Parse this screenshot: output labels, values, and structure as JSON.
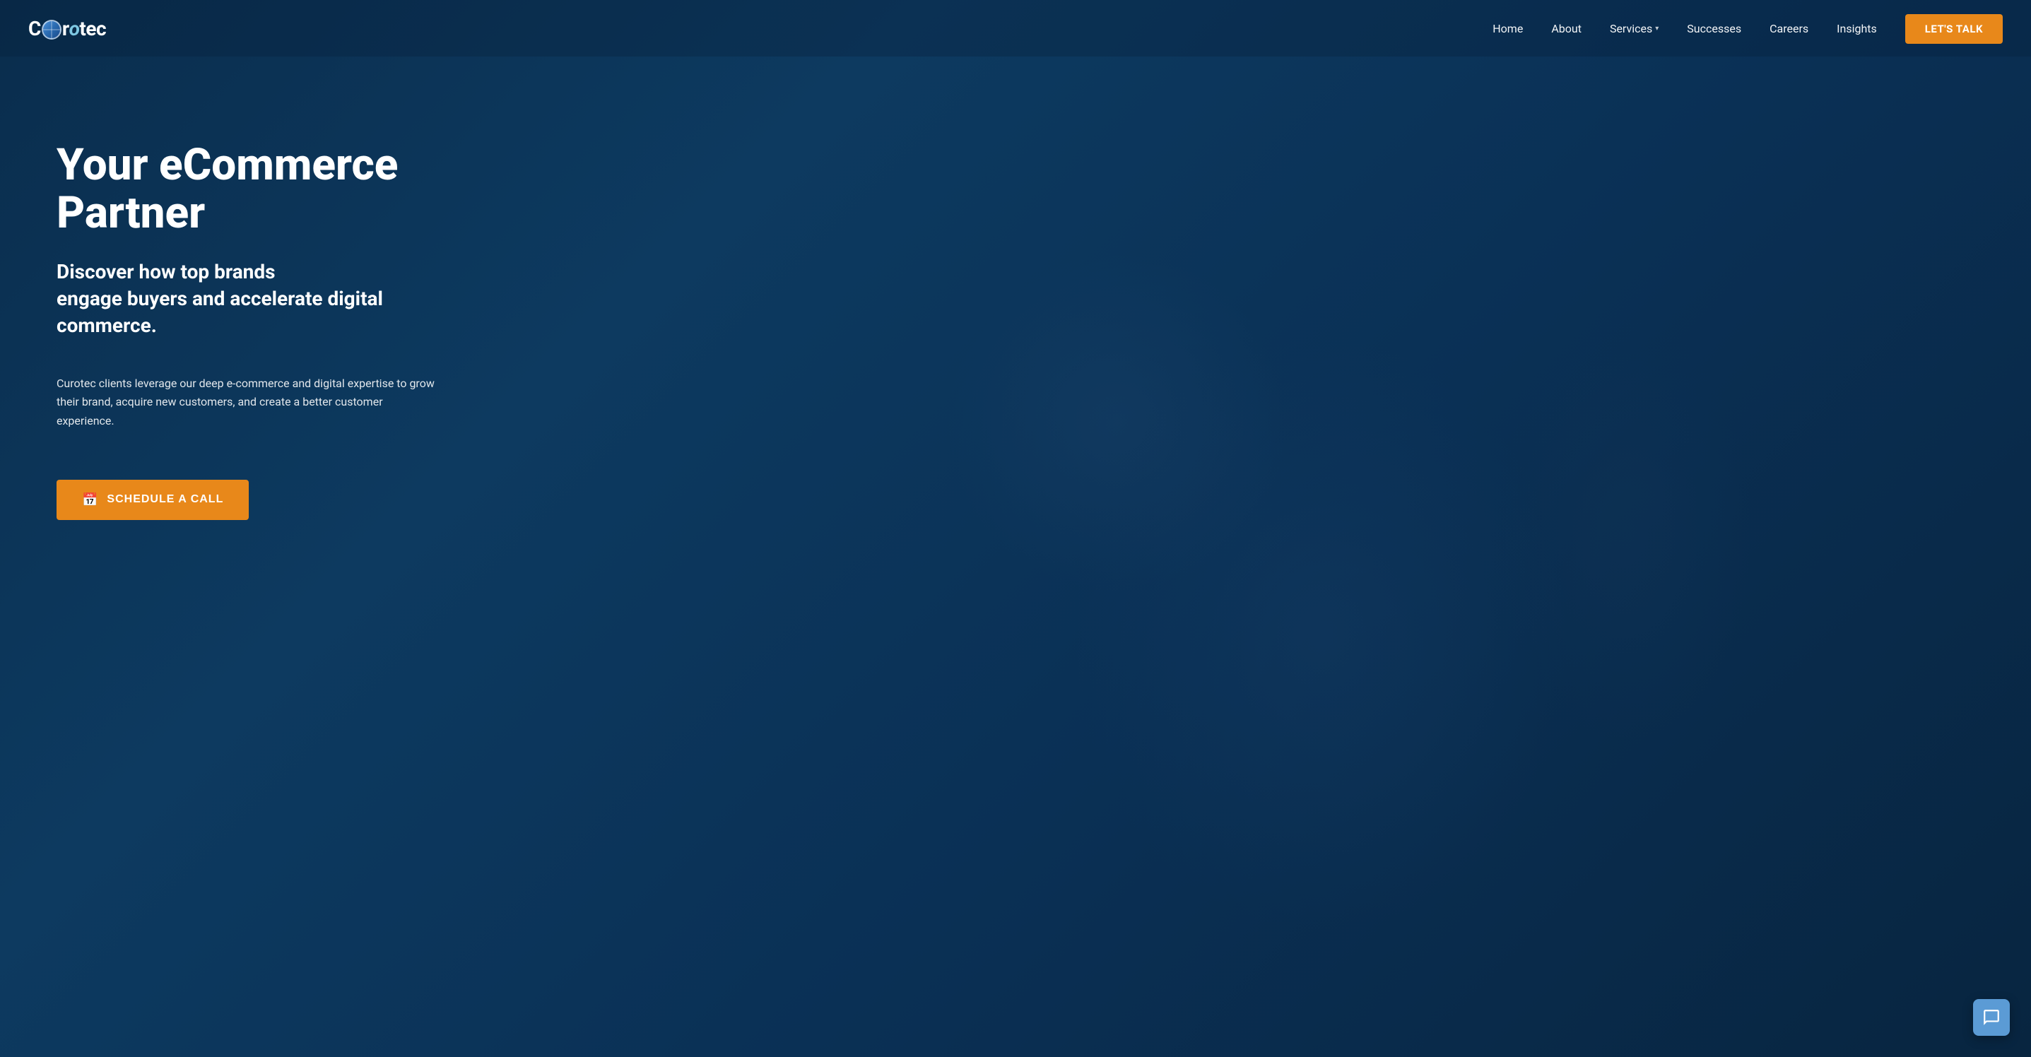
{
  "brand": {
    "name_part1": "C",
    "name_part2": "r",
    "name_part3": "tec",
    "full_name": "Curotec",
    "logo_letter": "ū"
  },
  "navbar": {
    "links": [
      {
        "id": "home",
        "label": "Home",
        "has_dropdown": false
      },
      {
        "id": "about",
        "label": "About",
        "has_dropdown": false
      },
      {
        "id": "services",
        "label": "Services",
        "has_dropdown": true
      },
      {
        "id": "successes",
        "label": "Successes",
        "has_dropdown": false
      },
      {
        "id": "careers",
        "label": "Careers",
        "has_dropdown": false
      },
      {
        "id": "insights",
        "label": "Insights",
        "has_dropdown": false
      }
    ],
    "cta_label": "LET'S TALK"
  },
  "hero": {
    "title": "Your eCommerce Partner",
    "subtitle": "Discover how top brands\nengage buyers and accelerate digital commerce.",
    "description": "Curotec clients leverage our deep e-commerce and digital expertise to grow their brand, acquire new customers, and create a better customer experience.",
    "cta_label": "SCHEDULE A CALL"
  },
  "chat": {
    "label": "chat-icon"
  },
  "colors": {
    "bg_dark": "#0a2d4d",
    "accent_orange": "#e8881a",
    "accent_blue": "#5b9bd5"
  }
}
